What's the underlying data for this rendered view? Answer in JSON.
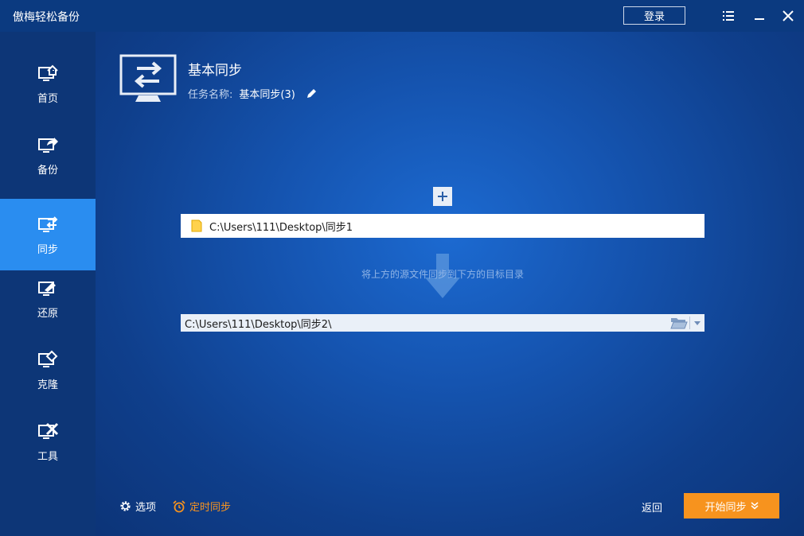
{
  "window": {
    "title": "傲梅轻松备份",
    "login_label": "登录"
  },
  "sidebar": {
    "items": [
      {
        "label": "首页",
        "icon": "home-monitor-icon"
      },
      {
        "label": "备份",
        "icon": "backup-monitor-icon"
      },
      {
        "label": "同步",
        "icon": "sync-monitor-icon",
        "active": true
      },
      {
        "label": "还原",
        "icon": "restore-monitor-icon"
      },
      {
        "label": "克隆",
        "icon": "clone-monitor-icon"
      },
      {
        "label": "工具",
        "icon": "tools-monitor-icon"
      }
    ]
  },
  "header": {
    "title": "基本同步",
    "task_name_label": "任务名称:",
    "task_name_value": "基本同步(3)"
  },
  "source": {
    "path": "C:\\Users\\111\\Desktop\\同步1"
  },
  "hint": "将上方的源文件同步到下方的目标目录",
  "destination": {
    "path": "C:\\Users\\111\\Desktop\\同步2\\"
  },
  "footer": {
    "options_label": "选项",
    "schedule_label": "定时同步",
    "back_label": "返回",
    "start_label": "开始同步"
  },
  "colors": {
    "accent_orange": "#f7931e",
    "active_blue": "#2a8df0",
    "sidebar_bg": "#0d3677"
  }
}
